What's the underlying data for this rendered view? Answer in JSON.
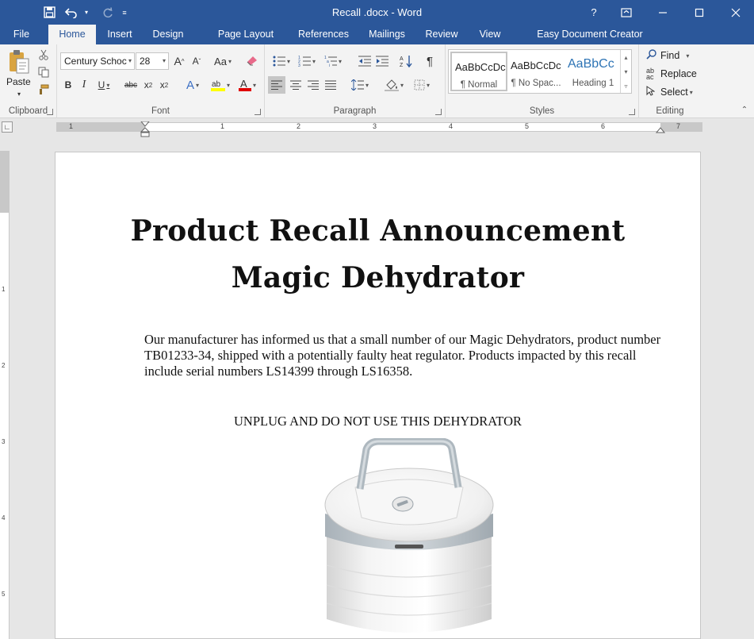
{
  "window": {
    "title": "Recall .docx  - Word"
  },
  "tabs": [
    {
      "label": "File"
    },
    {
      "label": "Home"
    },
    {
      "label": "Insert"
    },
    {
      "label": "Design"
    },
    {
      "label": "Page Layout"
    },
    {
      "label": "References"
    },
    {
      "label": "Mailings"
    },
    {
      "label": "Review"
    },
    {
      "label": "View"
    },
    {
      "label": "Easy Document Creator"
    }
  ],
  "ribbon": {
    "clipboard": {
      "label": "Clipboard",
      "paste": "Paste"
    },
    "font": {
      "label": "Font",
      "font_name": "Century Schoc",
      "font_size": "28"
    },
    "paragraph": {
      "label": "Paragraph"
    },
    "styles": {
      "label": "Styles",
      "items": [
        {
          "sample": "AaBbCcDc",
          "name": "¶ Normal"
        },
        {
          "sample": "AaBbCcDc",
          "name": "¶ No Spac..."
        },
        {
          "sample": "AaBbCc",
          "name": "Heading 1"
        }
      ]
    },
    "editing": {
      "label": "Editing",
      "find": "Find",
      "replace": "Replace",
      "select": "Select"
    }
  },
  "ruler": {
    "numbers": [
      "1",
      "1",
      "2",
      "3",
      "4",
      "5",
      "6",
      "7"
    ],
    "vnumbers": [
      "1",
      "2",
      "3",
      "4",
      "5"
    ]
  },
  "document": {
    "title_line1": "Product Recall Announcement",
    "title_line2": "Magic Dehydrator",
    "body": "Our manufacturer has informed us that a small number of our Magic Dehydrators, product number TB01233-34, shipped with a potentially faulty heat regulator. Products impacted by this recall include serial numbers LS14399 through LS16358.",
    "warning": "UNPLUG AND DO NOT USE THIS DEHYDRATOR"
  },
  "colors": {
    "accent": "#2b579a",
    "heading_style": "#2e74b5"
  }
}
